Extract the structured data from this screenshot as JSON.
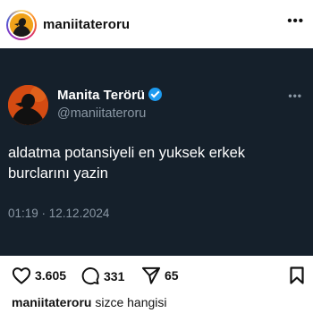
{
  "post": {
    "username": "maniitateroru",
    "more_icon": "more-horizontal-icon",
    "caption_user": "maniitateroru",
    "caption_text": "sizce hangisi"
  },
  "tweet": {
    "display_name": "Manita Terörü",
    "handle": "@maniitateroru",
    "text": "aldatma potansiyeli en yuksek erkek burclarını yazin",
    "timestamp": "01:19 · 12.12.2024",
    "background_color": "#15202b",
    "verified_color": "#1d9bf0"
  },
  "actions": {
    "likes": "3.605",
    "comments": "331",
    "shares": "65"
  }
}
